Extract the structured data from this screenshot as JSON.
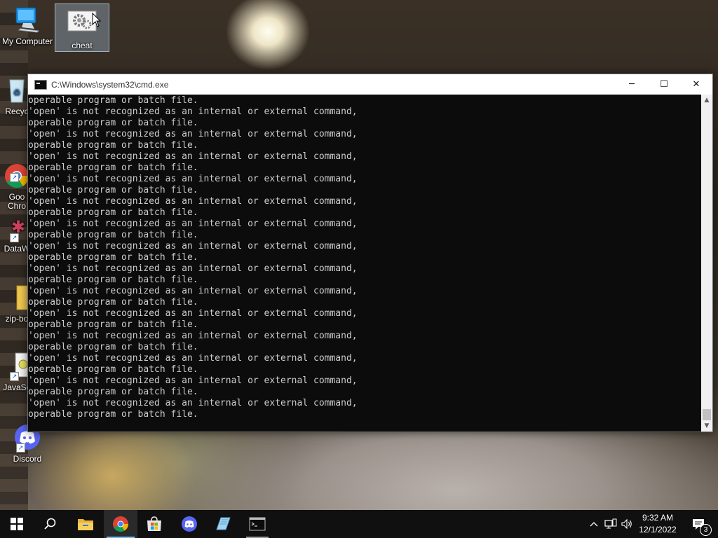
{
  "desktop": {
    "icons": [
      {
        "label": "My Computer",
        "icon": "computer-icon"
      },
      {
        "label": "cheat",
        "icon": "gears-icon"
      },
      {
        "label": "Recyc",
        "icon": "recycle-bin-icon"
      },
      {
        "label": "Goo\nChro",
        "icon": "chrome-icon"
      },
      {
        "label": "DataW",
        "icon": "datawrapper-icon"
      },
      {
        "label": "zip-bo",
        "icon": "folder-icon"
      },
      {
        "label": "JavaSc",
        "icon": "script-file-icon"
      },
      {
        "label": "Discord",
        "icon": "discord-icon"
      }
    ]
  },
  "cmd": {
    "title": "C:\\Windows\\system32\\cmd.exe",
    "lines": [
      "operable program or batch file.",
      "'open' is not recognized as an internal or external command,",
      "operable program or batch file.",
      "'open' is not recognized as an internal or external command,",
      "operable program or batch file.",
      "'open' is not recognized as an internal or external command,",
      "operable program or batch file.",
      "'open' is not recognized as an internal or external command,",
      "operable program or batch file.",
      "'open' is not recognized as an internal or external command,",
      "operable program or batch file.",
      "'open' is not recognized as an internal or external command,",
      "operable program or batch file.",
      "'open' is not recognized as an internal or external command,",
      "operable program or batch file.",
      "'open' is not recognized as an internal or external command,",
      "operable program or batch file.",
      "'open' is not recognized as an internal or external command,",
      "operable program or batch file.",
      "'open' is not recognized as an internal or external command,",
      "operable program or batch file.",
      "'open' is not recognized as an internal or external command,",
      "operable program or batch file.",
      "'open' is not recognized as an internal or external command,",
      "operable program or batch file.",
      "'open' is not recognized as an internal or external command,",
      "operable program or batch file.",
      "'open' is not recognized as an internal or external command,",
      "operable program or batch file."
    ],
    "buttons": {
      "minimize": "─",
      "maximize": "☐",
      "close": "✕"
    }
  },
  "taskbar": {
    "items": [
      "start-icon",
      "search-icon",
      "file-explorer-icon",
      "chrome-icon",
      "microsoft-store-icon",
      "discord-icon",
      "notepad-icon",
      "cmd-icon"
    ],
    "tray": {
      "chevron": "^",
      "time": "9:32 AM",
      "date": "12/1/2022",
      "notification_count": "3"
    }
  },
  "colors": {
    "taskbar_bg": "#101010",
    "console_bg": "#0c0c0c",
    "console_text": "#cccccc",
    "accent": "#76b9ed"
  }
}
